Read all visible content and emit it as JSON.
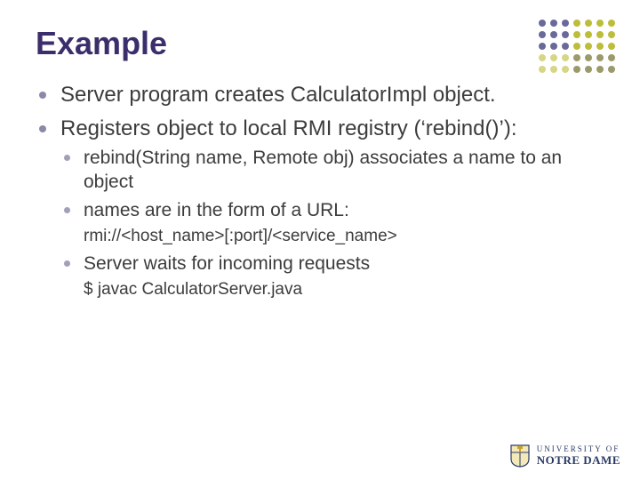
{
  "title": "Example",
  "bullets": {
    "b1": "Server program creates CalculatorImpl object.",
    "b2": "Registers object to local RMI registry (‘rebind()’):",
    "s1": "rebind(String name, Remote obj) associates a name to an object",
    "s2": "names are in the form of a URL:",
    "s2a": "rmi://<host_name>[:port]/<service_name>",
    "s3": "Server waits for incoming requests",
    "s3a": "$ javac CalculatorServer.java"
  },
  "logo": {
    "line1": "UNIVERSITY OF",
    "line2": "NOTRE DAME"
  },
  "decor": {
    "dot_colors": [
      "#6a6a9a",
      "#6a6a9a",
      "#6a6a9a",
      "#bdbd3a",
      "#bdbd3a",
      "#bdbd3a",
      "#bdbd3a",
      "#6a6a9a",
      "#6a6a9a",
      "#6a6a9a",
      "#bdbd3a",
      "#bdbd3a",
      "#bdbd3a",
      "#bdbd3a",
      "#6a6a9a",
      "#6a6a9a",
      "#6a6a9a",
      "#bdbd3a",
      "#bdbd3a",
      "#bdbd3a",
      "#bdbd3a",
      "#d6d686",
      "#d6d686",
      "#d6d686",
      "#9a9a6a",
      "#9a9a6a",
      "#9a9a6a",
      "#9a9a6a",
      "#d6d686",
      "#d6d686",
      "#d6d686",
      "#9a9a6a",
      "#9a9a6a",
      "#9a9a6a",
      "#9a9a6a"
    ]
  }
}
